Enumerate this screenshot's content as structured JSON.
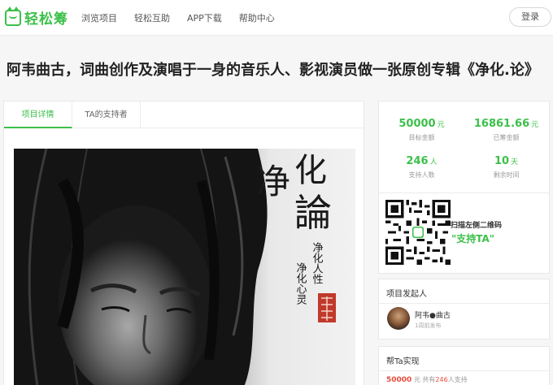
{
  "header": {
    "logo_text": "轻松筹",
    "nav": [
      "浏览项目",
      "轻松互助",
      "APP下载",
      "帮助中心"
    ],
    "login_label": "登录"
  },
  "project": {
    "title": "阿韦曲古，词曲创作及演唱于一身的音乐人、影视演员做一张原创专辑《净化.论》"
  },
  "tabs": [
    "项目详情",
    "TA的支持者"
  ],
  "cover": {
    "title_chars": [
      "净",
      "化",
      "論"
    ],
    "sub_line1": "净化人性",
    "sub_line2": "净化心灵",
    "seal": "阿韦曲古"
  },
  "stats": {
    "target": {
      "value": "50000",
      "unit": "元",
      "label": "目标金额"
    },
    "raised": {
      "value": "16861.66",
      "unit": "元",
      "label": "已筹金额"
    },
    "supporters": {
      "value": "246",
      "unit": "人",
      "label": "支持人数"
    },
    "remaining": {
      "value": "10",
      "unit": "天",
      "label": "剩余时间"
    }
  },
  "qr": {
    "line1": "扫描左侧二维码",
    "line2": "\"支持TA\""
  },
  "promoter": {
    "section_title": "项目发起人",
    "name": "阿韦●曲古",
    "time": "1周前发布"
  },
  "help": {
    "section_title": "帮Ta实现",
    "amount": "50000",
    "unit": "元",
    "mid": "共有",
    "count": "246",
    "suffix": "人支持"
  },
  "colors": {
    "accent": "#3cc04a",
    "alert": "#e74c3c"
  }
}
